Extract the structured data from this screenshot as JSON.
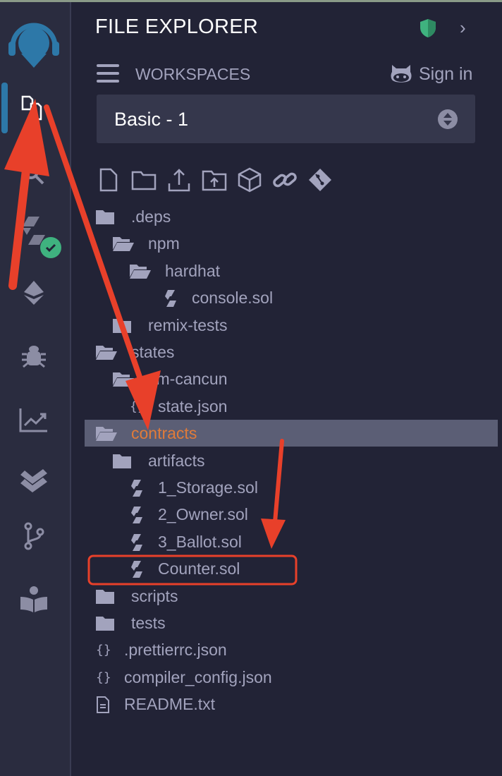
{
  "header": {
    "title": "FILE EXPLORER"
  },
  "workspaces": {
    "label": "WORKSPACES",
    "sign_in": "Sign in",
    "selected": "Basic - 1"
  },
  "sidebar": {
    "icons": [
      "file-explorer-icon",
      "search-icon",
      "solidity-compiler-icon",
      "deploy-run-icon",
      "debugger-icon",
      "analysis-icon",
      "unit-testing-icon",
      "git-icon",
      "learneth-icon"
    ],
    "compiler_status": "success"
  },
  "toolbar": [
    "new-file-icon",
    "new-folder-icon",
    "publish-icon",
    "upload-folder-icon",
    "cube-icon",
    "link-icon",
    "git-icon"
  ],
  "tree": [
    {
      "name": ".deps",
      "type": "folder",
      "level": 0
    },
    {
      "name": "npm",
      "type": "folder-open",
      "level": 1
    },
    {
      "name": "hardhat",
      "type": "folder-open",
      "level": 2
    },
    {
      "name": "console.sol",
      "type": "sol",
      "level": 3
    },
    {
      "name": "remix-tests",
      "type": "folder",
      "level": 1
    },
    {
      "name": "states",
      "type": "folder-open",
      "level": 0
    },
    {
      "name": "vm-cancun",
      "type": "folder-open",
      "level": 1
    },
    {
      "name": "state.json",
      "type": "json",
      "level": 2
    },
    {
      "name": "contracts",
      "type": "folder-open",
      "level": 0,
      "selected": true
    },
    {
      "name": "artifacts",
      "type": "folder",
      "level": 1
    },
    {
      "name": "1_Storage.sol",
      "type": "sol",
      "level": 1
    },
    {
      "name": "2_Owner.sol",
      "type": "sol",
      "level": 1
    },
    {
      "name": "3_Ballot.sol",
      "type": "sol",
      "level": 1
    },
    {
      "name": "Counter.sol",
      "type": "sol",
      "level": 1,
      "highlighted": true
    },
    {
      "name": "scripts",
      "type": "folder",
      "level": 0
    },
    {
      "name": "tests",
      "type": "folder",
      "level": 0
    },
    {
      "name": ".prettierrc.json",
      "type": "json",
      "level": 0
    },
    {
      "name": "compiler_config.json",
      "type": "json",
      "level": 0
    },
    {
      "name": "README.txt",
      "type": "text",
      "level": 0
    }
  ],
  "colors": {
    "background": "#222336",
    "sidebar": "#2a2c3f",
    "selected_row": "#5b5e75",
    "selected_text": "#e07b39",
    "annotation": "#e8402a",
    "success": "#3fb27f"
  }
}
